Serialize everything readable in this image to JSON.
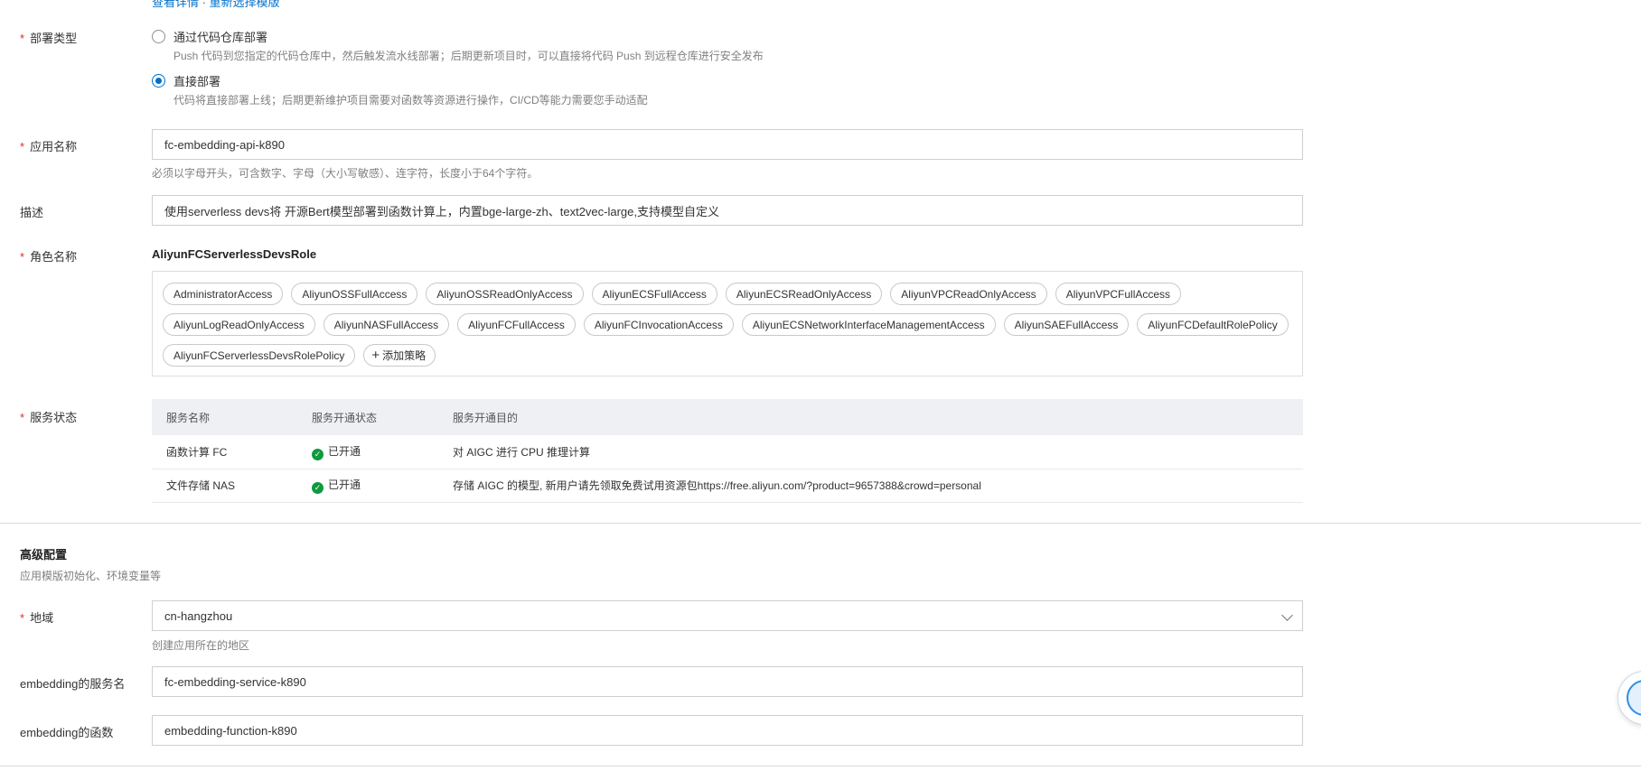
{
  "top_partial_link": "查看详情 · 重新选择模版",
  "deploy_type": {
    "label": "部署类型",
    "options": [
      {
        "label": "通过代码仓库部署",
        "desc": "Push 代码到您指定的代码仓库中，然后触发流水线部署；后期更新项目时，可以直接将代码 Push 到远程仓库进行安全发布",
        "selected": false
      },
      {
        "label": "直接部署",
        "desc": "代码将直接部署上线；后期更新维护项目需要对函数等资源进行操作，CI/CD等能力需要您手动适配",
        "selected": true
      }
    ]
  },
  "app_name": {
    "label": "应用名称",
    "value": "fc-embedding-api-k890",
    "help": "必须以字母开头，可含数字、字母（大小写敏感）、连字符，长度小于64个字符。"
  },
  "description": {
    "label": "描述",
    "value": "使用serverless devs将  开源Bert模型部署到函数计算上，内置bge-large-zh、text2vec-large,支持模型自定义"
  },
  "role": {
    "label": "角色名称",
    "name": "AliyunFCServerlessDevsRole",
    "policies": [
      "AdministratorAccess",
      "AliyunOSSFullAccess",
      "AliyunOSSReadOnlyAccess",
      "AliyunECSFullAccess",
      "AliyunECSReadOnlyAccess",
      "AliyunVPCReadOnlyAccess",
      "AliyunVPCFullAccess",
      "AliyunLogReadOnlyAccess",
      "AliyunNASFullAccess",
      "AliyunFCFullAccess",
      "AliyunFCInvocationAccess",
      "AliyunECSNetworkInterfaceManagementAccess",
      "AliyunSAEFullAccess",
      "AliyunFCDefaultRolePolicy",
      "AliyunFCServerlessDevsRolePolicy"
    ],
    "add_policy_label": "添加策略"
  },
  "service_status": {
    "label": "服务状态",
    "columns": [
      "服务名称",
      "服务开通状态",
      "服务开通目的"
    ],
    "rows": [
      {
        "name": "函数计算 FC",
        "status": "已开通",
        "purpose": "对 AIGC 进行 CPU 推理计算"
      },
      {
        "name": "文件存储 NAS",
        "status": "已开通",
        "purpose": "存储 AIGC 的模型, 新用户请先领取免费试用资源包https://free.aliyun.com/?product=9657388&crowd=personal"
      }
    ]
  },
  "advanced": {
    "title": "高级配置",
    "subtitle": "应用模版初始化、环境变量等"
  },
  "region": {
    "label": "地域",
    "value": "cn-hangzhou",
    "help": "创建应用所在的地区"
  },
  "embedding_service": {
    "label": "embedding的服务名",
    "value": "fc-embedding-service-k890"
  },
  "embedding_function": {
    "label": "embedding的函数",
    "value": "embedding-function-k890"
  },
  "colors": {
    "accent": "#0070cc",
    "required": "#d93026",
    "success": "#0d9a3e",
    "table_header_bg": "#eef0f3"
  }
}
